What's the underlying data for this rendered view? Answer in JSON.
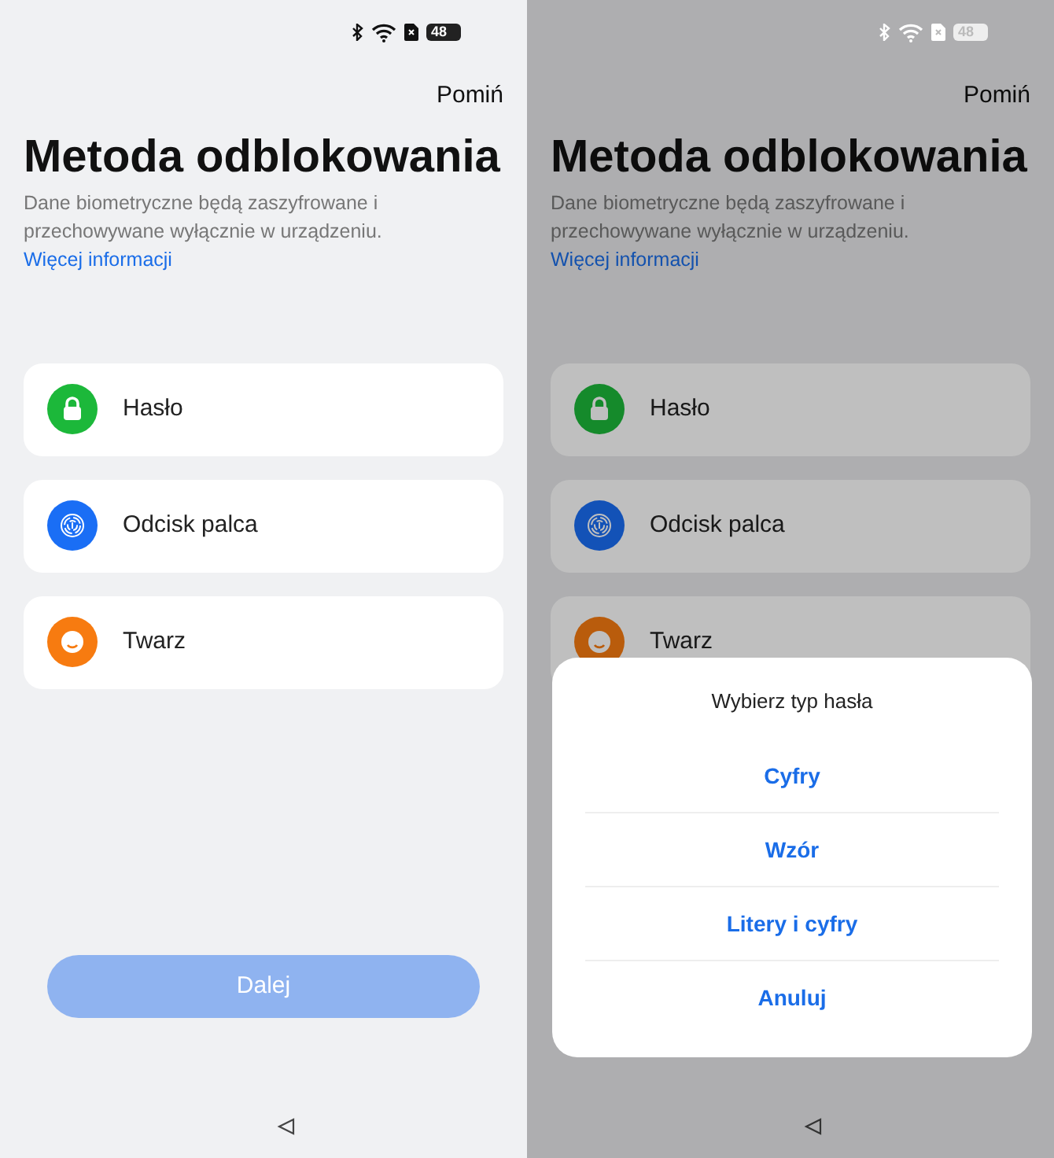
{
  "screens": [
    {
      "dimmed": false,
      "status_bar": {
        "battery": "48"
      },
      "skip": "Pomiń",
      "title": "Metoda odblokowania",
      "description": "Dane biometryczne będą zaszyfrowane i przechowywane wyłącznie w urządzeniu.",
      "link": "Więcej informacji",
      "methods": [
        {
          "kind": "password",
          "label": "Hasło"
        },
        {
          "kind": "fingerprint",
          "label": "Odcisk palca"
        },
        {
          "kind": "face",
          "label": "Twarz"
        }
      ],
      "next_button": {
        "label": "Dalej",
        "disabled": true
      }
    },
    {
      "dimmed": true,
      "status_bar": {
        "battery": "48"
      },
      "skip": "Pomiń",
      "title": "Metoda odblokowania",
      "description": "Dane biometryczne będą zaszyfrowane i przechowywane wyłącznie w urządzeniu.",
      "link": "Więcej informacji",
      "methods": [
        {
          "kind": "password",
          "label": "Hasło"
        },
        {
          "kind": "fingerprint",
          "label": "Odcisk palca"
        },
        {
          "kind": "face",
          "label": "Twarz"
        }
      ],
      "sheet": {
        "title": "Wybierz typ hasła",
        "options": [
          "Cyfry",
          "Wzór",
          "Litery i cyfry"
        ],
        "cancel": "Anuluj"
      }
    }
  ]
}
